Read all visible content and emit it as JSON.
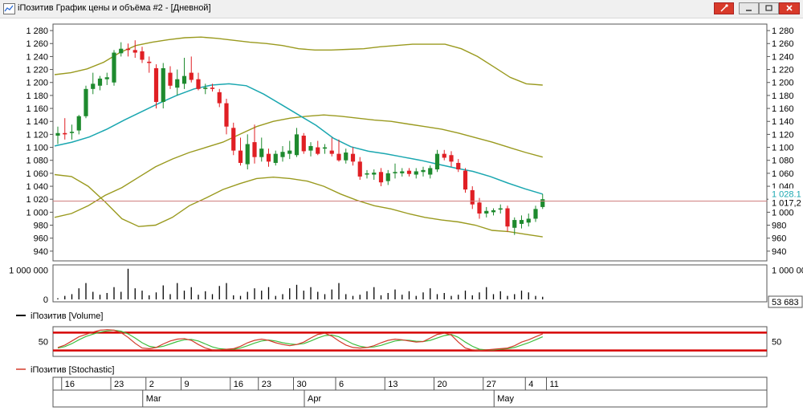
{
  "window": {
    "title": "iПозитив График цены и объёма #2 - [Дневной]",
    "icons": [
      "chart-app-icon",
      "pin-icon",
      "minimize-icon",
      "restore-icon",
      "close-icon"
    ]
  },
  "chart_data": {
    "type": "candlestick",
    "price_axis": {
      "ylim": [
        925,
        1290
      ],
      "ticks": [
        1280,
        1260,
        1240,
        1220,
        1200,
        1180,
        1160,
        1140,
        1120,
        1100,
        1080,
        1060,
        1040,
        1020,
        1000,
        980,
        960,
        940
      ],
      "tick_labels": [
        "1 280",
        "1 260",
        "1 240",
        "1 220",
        "1 200",
        "1 180",
        "1 160",
        "1 140",
        "1 120",
        "1 100",
        "1 080",
        "1 060",
        "1 040",
        "1 020",
        "1 000",
        "980",
        "960",
        "940"
      ]
    },
    "last_price": {
      "value": 1017.2,
      "label": "1 017,2",
      "color": "#c00000"
    },
    "ma_last": {
      "value": 1028.1,
      "label": "1 028,1",
      "color": "#1aa7b0"
    },
    "candles": [
      {
        "o": 1118,
        "h": 1132,
        "l": 1105,
        "c": 1122
      },
      {
        "o": 1122,
        "h": 1145,
        "l": 1112,
        "c": 1120
      },
      {
        "o": 1122,
        "h": 1135,
        "l": 1112,
        "c": 1124
      },
      {
        "o": 1126,
        "h": 1150,
        "l": 1120,
        "c": 1148
      },
      {
        "o": 1148,
        "h": 1195,
        "l": 1145,
        "c": 1190
      },
      {
        "o": 1190,
        "h": 1215,
        "l": 1182,
        "c": 1198
      },
      {
        "o": 1195,
        "h": 1210,
        "l": 1188,
        "c": 1206
      },
      {
        "o": 1205,
        "h": 1215,
        "l": 1196,
        "c": 1208
      },
      {
        "o": 1200,
        "h": 1250,
        "l": 1195,
        "c": 1246
      },
      {
        "o": 1245,
        "h": 1262,
        "l": 1240,
        "c": 1252
      },
      {
        "o": 1252,
        "h": 1260,
        "l": 1240,
        "c": 1250
      },
      {
        "o": 1250,
        "h": 1265,
        "l": 1238,
        "c": 1246
      },
      {
        "o": 1248,
        "h": 1255,
        "l": 1230,
        "c": 1235
      },
      {
        "o": 1232,
        "h": 1240,
        "l": 1215,
        "c": 1230
      },
      {
        "o": 1222,
        "h": 1228,
        "l": 1160,
        "c": 1170
      },
      {
        "o": 1170,
        "h": 1230,
        "l": 1160,
        "c": 1222
      },
      {
        "o": 1215,
        "h": 1225,
        "l": 1190,
        "c": 1195
      },
      {
        "o": 1192,
        "h": 1220,
        "l": 1180,
        "c": 1205
      },
      {
        "o": 1198,
        "h": 1238,
        "l": 1190,
        "c": 1210
      },
      {
        "o": 1215,
        "h": 1240,
        "l": 1200,
        "c": 1204
      },
      {
        "o": 1205,
        "h": 1215,
        "l": 1188,
        "c": 1190
      },
      {
        "o": 1190,
        "h": 1198,
        "l": 1182,
        "c": 1192
      },
      {
        "o": 1192,
        "h": 1198,
        "l": 1186,
        "c": 1190
      },
      {
        "o": 1185,
        "h": 1190,
        "l": 1162,
        "c": 1168
      },
      {
        "o": 1168,
        "h": 1175,
        "l": 1120,
        "c": 1132
      },
      {
        "o": 1130,
        "h": 1138,
        "l": 1088,
        "c": 1095
      },
      {
        "o": 1095,
        "h": 1115,
        "l": 1072,
        "c": 1076
      },
      {
        "o": 1074,
        "h": 1120,
        "l": 1066,
        "c": 1105
      },
      {
        "o": 1108,
        "h": 1135,
        "l": 1075,
        "c": 1085
      },
      {
        "o": 1085,
        "h": 1115,
        "l": 1078,
        "c": 1098
      },
      {
        "o": 1090,
        "h": 1098,
        "l": 1070,
        "c": 1078
      },
      {
        "o": 1076,
        "h": 1095,
        "l": 1072,
        "c": 1090
      },
      {
        "o": 1085,
        "h": 1102,
        "l": 1078,
        "c": 1093
      },
      {
        "o": 1090,
        "h": 1110,
        "l": 1082,
        "c": 1095
      },
      {
        "o": 1088,
        "h": 1130,
        "l": 1085,
        "c": 1120
      },
      {
        "o": 1118,
        "h": 1122,
        "l": 1090,
        "c": 1094
      },
      {
        "o": 1095,
        "h": 1108,
        "l": 1086,
        "c": 1102
      },
      {
        "o": 1100,
        "h": 1110,
        "l": 1088,
        "c": 1090
      },
      {
        "o": 1098,
        "h": 1105,
        "l": 1090,
        "c": 1100
      },
      {
        "o": 1095,
        "h": 1115,
        "l": 1086,
        "c": 1090
      },
      {
        "o": 1090,
        "h": 1112,
        "l": 1078,
        "c": 1080
      },
      {
        "o": 1080,
        "h": 1098,
        "l": 1075,
        "c": 1092
      },
      {
        "o": 1090,
        "h": 1100,
        "l": 1072,
        "c": 1078
      },
      {
        "o": 1078,
        "h": 1085,
        "l": 1050,
        "c": 1055
      },
      {
        "o": 1058,
        "h": 1065,
        "l": 1052,
        "c": 1060
      },
      {
        "o": 1058,
        "h": 1066,
        "l": 1050,
        "c": 1061
      },
      {
        "o": 1062,
        "h": 1068,
        "l": 1040,
        "c": 1046
      },
      {
        "o": 1048,
        "h": 1065,
        "l": 1042,
        "c": 1060
      },
      {
        "o": 1060,
        "h": 1075,
        "l": 1052,
        "c": 1062
      },
      {
        "o": 1060,
        "h": 1068,
        "l": 1055,
        "c": 1063
      },
      {
        "o": 1064,
        "h": 1068,
        "l": 1055,
        "c": 1059
      },
      {
        "o": 1058,
        "h": 1068,
        "l": 1052,
        "c": 1063
      },
      {
        "o": 1062,
        "h": 1070,
        "l": 1055,
        "c": 1065
      },
      {
        "o": 1058,
        "h": 1072,
        "l": 1052,
        "c": 1068
      },
      {
        "o": 1066,
        "h": 1096,
        "l": 1062,
        "c": 1090
      },
      {
        "o": 1090,
        "h": 1096,
        "l": 1080,
        "c": 1084
      },
      {
        "o": 1088,
        "h": 1094,
        "l": 1070,
        "c": 1078
      },
      {
        "o": 1076,
        "h": 1082,
        "l": 1062,
        "c": 1066
      },
      {
        "o": 1064,
        "h": 1068,
        "l": 1030,
        "c": 1035
      },
      {
        "o": 1034,
        "h": 1040,
        "l": 1005,
        "c": 1012
      },
      {
        "o": 1015,
        "h": 1022,
        "l": 990,
        "c": 998
      },
      {
        "o": 998,
        "h": 1008,
        "l": 992,
        "c": 1002
      },
      {
        "o": 1000,
        "h": 1006,
        "l": 995,
        "c": 1003
      },
      {
        "o": 1004,
        "h": 1012,
        "l": 998,
        "c": 1006
      },
      {
        "o": 1006,
        "h": 1010,
        "l": 970,
        "c": 978
      },
      {
        "o": 976,
        "h": 992,
        "l": 965,
        "c": 988
      },
      {
        "o": 982,
        "h": 995,
        "l": 975,
        "c": 988
      },
      {
        "o": 984,
        "h": 998,
        "l": 978,
        "c": 990
      },
      {
        "o": 990,
        "h": 1010,
        "l": 985,
        "c": 1005
      },
      {
        "o": 1008,
        "h": 1028,
        "l": 1005,
        "c": 1020
      }
    ],
    "bollinger": {
      "upper": [
        1212,
        1215,
        1221,
        1231,
        1246,
        1257,
        1262,
        1266,
        1269,
        1270,
        1268,
        1265,
        1262,
        1260,
        1257,
        1252,
        1250,
        1250,
        1251,
        1252,
        1255,
        1257,
        1259,
        1259,
        1259,
        1252,
        1240,
        1224,
        1208,
        1198,
        1196
      ],
      "middle": [
        1102,
        1108,
        1116,
        1128,
        1142,
        1155,
        1168,
        1180,
        1190,
        1196,
        1198,
        1195,
        1182,
        1166,
        1150,
        1134,
        1114,
        1101,
        1094,
        1090,
        1085,
        1080,
        1074,
        1068,
        1063,
        1055,
        1045,
        1036,
        1028
      ],
      "lower": [
        992,
        998,
        1010,
        1026,
        1038,
        1054,
        1070,
        1082,
        1092,
        1100,
        1108,
        1120,
        1132,
        1140,
        1145,
        1148,
        1150,
        1148,
        1145,
        1142,
        1140,
        1136,
        1132,
        1128,
        1122,
        1115,
        1108,
        1100,
        1092,
        1085
      ],
      "deviation": [
        1058,
        1055,
        1040,
        1016,
        990,
        978,
        980,
        992,
        1010,
        1022,
        1035,
        1044,
        1052,
        1054,
        1052,
        1048,
        1040,
        1028,
        1018,
        1010,
        1005,
        998,
        992,
        988,
        985,
        980,
        972,
        970,
        966,
        962
      ]
    },
    "volume": {
      "axis_labels": [
        "1 000 000",
        "0"
      ],
      "last_label": "53 683",
      "legend": "iПозитив [Volume]",
      "values": [
        40,
        120,
        180,
        380,
        560,
        260,
        160,
        220,
        420,
        260,
        1050,
        380,
        300,
        140,
        240,
        480,
        180,
        560,
        300,
        420,
        160,
        280,
        180,
        460,
        560,
        140,
        120,
        260,
        380,
        300,
        420,
        120,
        180,
        380,
        500,
        300,
        420,
        260,
        180,
        340,
        560,
        180,
        120,
        160,
        280,
        420,
        140,
        220,
        340,
        160,
        280,
        120,
        240,
        380,
        180,
        220,
        120,
        160,
        300,
        140,
        240,
        420,
        180,
        280,
        120,
        180,
        300,
        240,
        120,
        90
      ]
    },
    "stochastic": {
      "axis_label": "50",
      "legend": "iПозитив [Stochastic]",
      "levels": [
        80,
        20
      ],
      "k": [
        30,
        38,
        52,
        66,
        74,
        82,
        88,
        90,
        88,
        80,
        64,
        44,
        28,
        26,
        30,
        42,
        52,
        58,
        60,
        54,
        40,
        28,
        22,
        22,
        24,
        26,
        34,
        46,
        54,
        58,
        54,
        46,
        40,
        36,
        40,
        48,
        62,
        74,
        78,
        68,
        52,
        38,
        30,
        28,
        30,
        36,
        46,
        54,
        58,
        56,
        52,
        48,
        50,
        62,
        74,
        78,
        72,
        48,
        28,
        22,
        20,
        22,
        24,
        26,
        28,
        36,
        48,
        56,
        66,
        76
      ],
      "d": [
        28,
        33,
        43,
        56,
        67,
        75,
        82,
        86,
        88,
        85,
        76,
        62,
        46,
        34,
        30,
        34,
        42,
        50,
        56,
        57,
        52,
        42,
        32,
        26,
        24,
        24,
        28,
        36,
        45,
        52,
        55,
        52,
        46,
        42,
        40,
        43,
        52,
        62,
        70,
        72,
        66,
        54,
        42,
        34,
        30,
        32,
        37,
        45,
        52,
        55,
        54,
        51,
        50,
        54,
        62,
        70,
        74,
        64,
        48,
        34,
        24,
        22,
        22,
        24,
        26,
        30,
        38,
        46,
        56,
        66
      ],
      "k_color": "#d23a2a",
      "d_color": "#3fbf3f"
    },
    "x_axis": {
      "day_labels": [
        "16",
        "23",
        "2",
        "9",
        "16",
        "23",
        "30",
        "6",
        "13",
        "20",
        "27",
        "4",
        "11"
      ],
      "month_labels": [
        "Mar",
        "Apr",
        "May"
      ]
    },
    "colors": {
      "up": "#1e8a2e",
      "down": "#e01f24",
      "band": "#9a9a1f",
      "ma": "#1aa7b0",
      "level": "#d60000"
    }
  }
}
